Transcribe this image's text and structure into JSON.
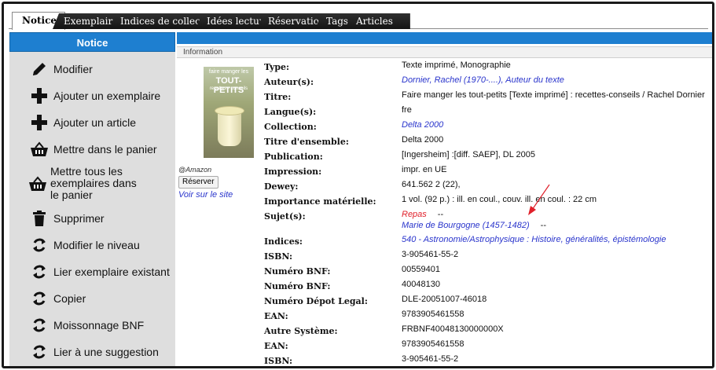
{
  "tabs": [
    "Notice",
    "Exemplaires",
    "Indices de collection",
    "Idées lectures",
    "Réservations",
    "Tags",
    "Articles"
  ],
  "sidebar": {
    "title": "Notice",
    "items": [
      {
        "label": "Modifier",
        "icon": "pencil-icon"
      },
      {
        "label": "Ajouter un exemplaire",
        "icon": "plus-icon"
      },
      {
        "label": "Ajouter un article",
        "icon": "plus-icon"
      },
      {
        "label": "Mettre dans le panier",
        "icon": "basket-icon"
      },
      {
        "label": "Mettre tous les exemplaires dans le panier",
        "icon": "basket-icon"
      },
      {
        "label": "Supprimer",
        "icon": "trash-icon"
      },
      {
        "label": "Modifier le niveau",
        "icon": "refresh-icon"
      },
      {
        "label": "Lier exemplaire existant",
        "icon": "refresh-icon"
      },
      {
        "label": "Copier",
        "icon": "refresh-icon"
      },
      {
        "label": "Moissonnage BNF",
        "icon": "refresh-icon"
      },
      {
        "label": "Lier à une suggestion",
        "icon": "refresh-icon"
      }
    ]
  },
  "section_header": "Information",
  "cover": {
    "line1": "faire manger les",
    "line2": "TOUT-PETITS",
    "line3": "recettes - conseils",
    "source": "@Amazon"
  },
  "reserve_button": "Réserver",
  "site_link": "Voir sur le site",
  "fields": [
    {
      "label": "Type:",
      "value": "Texte imprimé, Monographie",
      "style": "plain"
    },
    {
      "label": "Auteur(s):",
      "value": "Dornier, Rachel (1970-....), Auteur du texte",
      "style": "link"
    },
    {
      "label": "Titre:",
      "value": "Faire manger les tout-petits [Texte imprimé] : recettes-conseils / Rachel Dornier",
      "style": "plain"
    },
    {
      "label": "Langue(s):",
      "value": "fre",
      "style": "plain"
    },
    {
      "label": "Collection:",
      "value": "Delta 2000",
      "style": "link"
    },
    {
      "label": "Titre d'ensemble:",
      "value": "Delta 2000",
      "style": "plain"
    },
    {
      "label": "Publication:",
      "value": "[Ingersheim] :[diff. SAEP], DL 2005",
      "style": "plain"
    },
    {
      "label": "Impression:",
      "value": "impr. en UE",
      "style": "plain"
    },
    {
      "label": "Dewey:",
      "value": "641.562 2 (22),",
      "style": "plain"
    },
    {
      "label": "Importance matérielle:",
      "value": "1 vol. (92 p.) : ill. en coul., couv. ill. en coul. : 22 cm",
      "style": "plain"
    },
    {
      "label": "Sujet(s):",
      "value": "Repas",
      "style": "red",
      "value2": "Marie de Bourgogne (1457-1482)",
      "separator": "--"
    },
    {
      "label": "Indices:",
      "value": "540 - Astronomie/Astrophysique : Histoire, généralités, épistémologie",
      "style": "link"
    },
    {
      "label": "ISBN:",
      "value": "3-905461-55-2",
      "style": "plain"
    },
    {
      "label": "Numéro BNF:",
      "value": "00559401",
      "style": "plain"
    },
    {
      "label": "Numéro BNF:",
      "value": "40048130",
      "style": "plain"
    },
    {
      "label": "Numéro Dépot Legal:",
      "value": "DLE-20051007-46018",
      "style": "plain"
    },
    {
      "label": "EAN:",
      "value": "9783905461558",
      "style": "plain"
    },
    {
      "label": "Autre Système:",
      "value": "FRBNF40048130000000X",
      "style": "plain"
    },
    {
      "label": "EAN:",
      "value": "9783905461558",
      "style": "plain"
    },
    {
      "label": "ISBN:",
      "value": "3-905461-55-2",
      "style": "plain"
    }
  ],
  "colors": {
    "accent": "#1e7fd0",
    "link": "#2a35cc",
    "red_link": "#e0202a",
    "annotation_arrow": "#e0202a"
  }
}
